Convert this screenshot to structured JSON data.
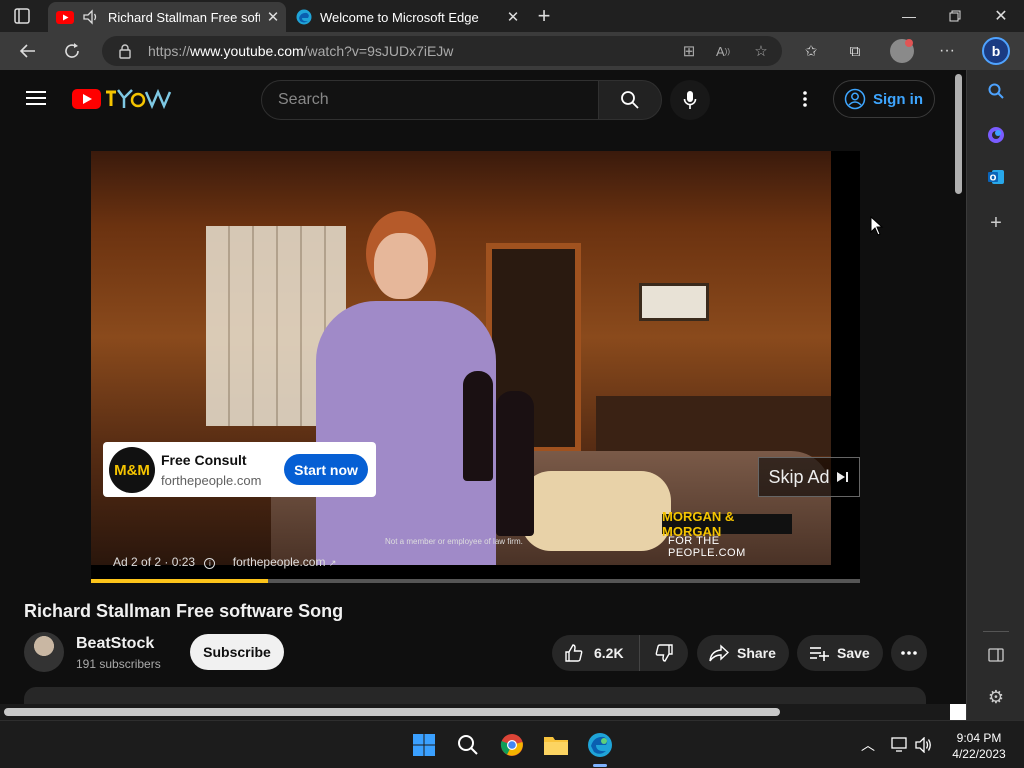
{
  "browser": {
    "tabs": [
      {
        "title": "Richard Stallman Free software Song",
        "active": true
      },
      {
        "title": "Welcome to Microsoft Edge",
        "active": false
      }
    ],
    "url_scheme": "https://",
    "url_host": "www.youtube.com",
    "url_path": "/watch?v=9sJUDx7iEJw"
  },
  "youtube": {
    "search_placeholder": "Search",
    "sign_in_label": "Sign in",
    "ad": {
      "card_title": "Free Consult",
      "card_domain": "forthepeople.com",
      "card_cta": "Start now",
      "logo_text": "M&M",
      "skip_label": "Skip Ad",
      "brand_name": "MORGAN & MORGAN",
      "brand_sub": "FOR THE PEOPLE.COM",
      "disclaimer": "Not a member or employee of law firm.",
      "position_text": "Ad 2 of 2 · 0:23",
      "link_text": "forthepeople.com",
      "progress": 0.23
    },
    "video": {
      "title": "Richard Stallman Free software Song",
      "channel": "BeatStock",
      "subscribers": "191 subscribers",
      "subscribe_label": "Subscribe",
      "likes": "6.2K",
      "share_label": "Share",
      "save_label": "Save"
    }
  },
  "taskbar": {
    "time": "9:04 PM",
    "date": "4/22/2023"
  },
  "colors": {
    "youtube_red": "#ff0000",
    "link_blue": "#3ea6ff",
    "cta_blue": "#065fd4",
    "ad_yellow": "#fcc41a"
  }
}
